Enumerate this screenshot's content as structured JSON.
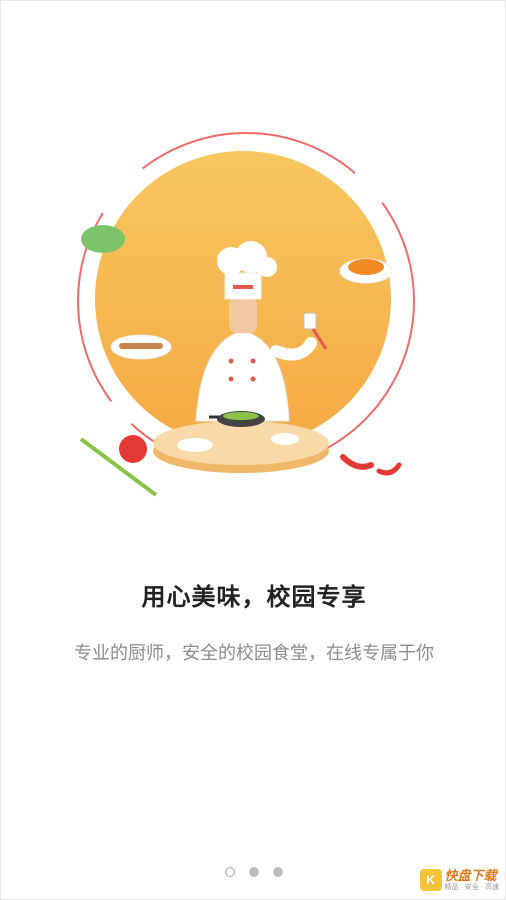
{
  "onboarding": {
    "title": "用心美味，校园专享",
    "subtitle": "专业的厨师，安全的校园食堂，在线专属于你"
  },
  "pager": {
    "total": 3,
    "current": 1
  },
  "watermark": {
    "logo_char": "K",
    "brand": "快盘下载",
    "tagline": "精品 · 安全 · 高速"
  },
  "icons": {
    "illustration": "chef-cooking-illustration",
    "logo": "kuaipan-logo-icon"
  },
  "colors": {
    "circle_fill": "#f7b94f",
    "ring": "#f06a6a",
    "title": "#222222",
    "subtitle": "#8c8c8c"
  }
}
